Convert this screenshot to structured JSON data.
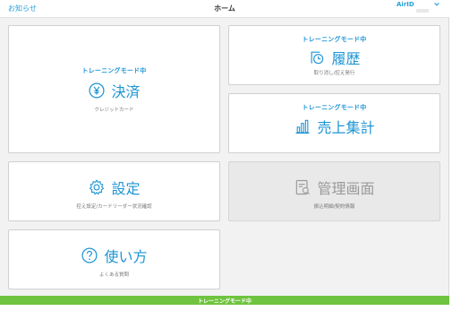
{
  "header": {
    "news_label": "お知らせ",
    "title": "ホーム",
    "account_label": "AirID"
  },
  "cards": {
    "payment": {
      "training": "トレーニングモード中",
      "label": "決済",
      "sub": "クレジットカード",
      "icon": "yen-circle-icon"
    },
    "history": {
      "training": "トレーニングモード中",
      "label": "履歴",
      "sub": "取り消し/控え発行",
      "icon": "clock-document-icon"
    },
    "sales": {
      "training": "トレーニングモード中",
      "label": "売上集計",
      "sub": "",
      "icon": "bar-chart-icon"
    },
    "settings": {
      "label": "設定",
      "sub": "控え設定/カードリーダー状況確認",
      "icon": "gear-icon"
    },
    "management": {
      "label": "管理画面",
      "sub": "振込明細/契約情報",
      "icon": "admin-panel-icon",
      "disabled": true
    },
    "help": {
      "label": "使い方",
      "sub": "よくある質問",
      "icon": "question-circle-icon"
    }
  },
  "footer": {
    "label": "トレーニングモード中"
  },
  "colors": {
    "accent": "#1e95d4",
    "training_bar": "#6fc43f",
    "disabled": "#9a9a9a"
  }
}
